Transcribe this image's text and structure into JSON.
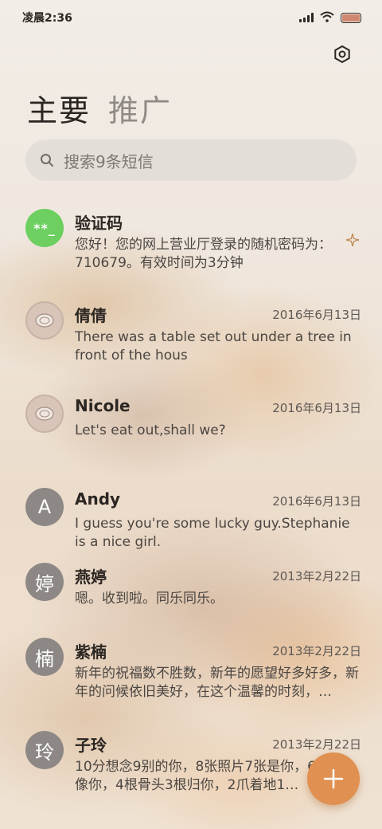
{
  "status_bar": {
    "time": "凌晨2:36"
  },
  "tabs": [
    {
      "label": "主要",
      "active": true
    },
    {
      "label": "推广",
      "active": false
    }
  ],
  "search": {
    "placeholder": "搜索9条短信"
  },
  "conversations": [
    {
      "name": "验证码",
      "avatar_text": "**_",
      "date": "",
      "preview": "您好！您的网上营业厅登录的随机密码为：710679。有效时间为3分钟"
    },
    {
      "name": "倩倩",
      "avatar_text": "",
      "date": "2016年6月13日",
      "preview": "There was a table set out under a tree in front of the hous"
    },
    {
      "name": "Nicole",
      "avatar_text": "",
      "date": "2016年6月13日",
      "preview": "Let's eat out,shall we?"
    },
    {
      "name": "Andy",
      "avatar_text": "A",
      "date": "2016年6月13日",
      "preview": "I guess you're some lucky guy.Stephanie is a nice girl."
    },
    {
      "name": "燕婷",
      "avatar_text": "婷",
      "date": "2013年2月22日",
      "preview": "嗯。收到啦。同乐同乐。"
    },
    {
      "name": "紫楠",
      "avatar_text": "楠",
      "date": "2013年2月22日",
      "preview": "新年的祝福数不胜数，新年的愿望好多好多，新年的问候依旧美好，在这个温馨的时刻，…"
    },
    {
      "name": "子玲",
      "avatar_text": "玲",
      "date": "2013年2月22日",
      "preview": "10分想念9别的你，8张照片7张是你，6…5只像你，4根骨头3根归你，2爪着地1…"
    }
  ],
  "colors": {
    "accent": "#e09050",
    "verify_avatar": "#6ccf5f"
  },
  "icons": {
    "settings": "settings-icon",
    "search": "search-icon",
    "compose": "plus-icon",
    "ai": "sparkle-icon"
  }
}
